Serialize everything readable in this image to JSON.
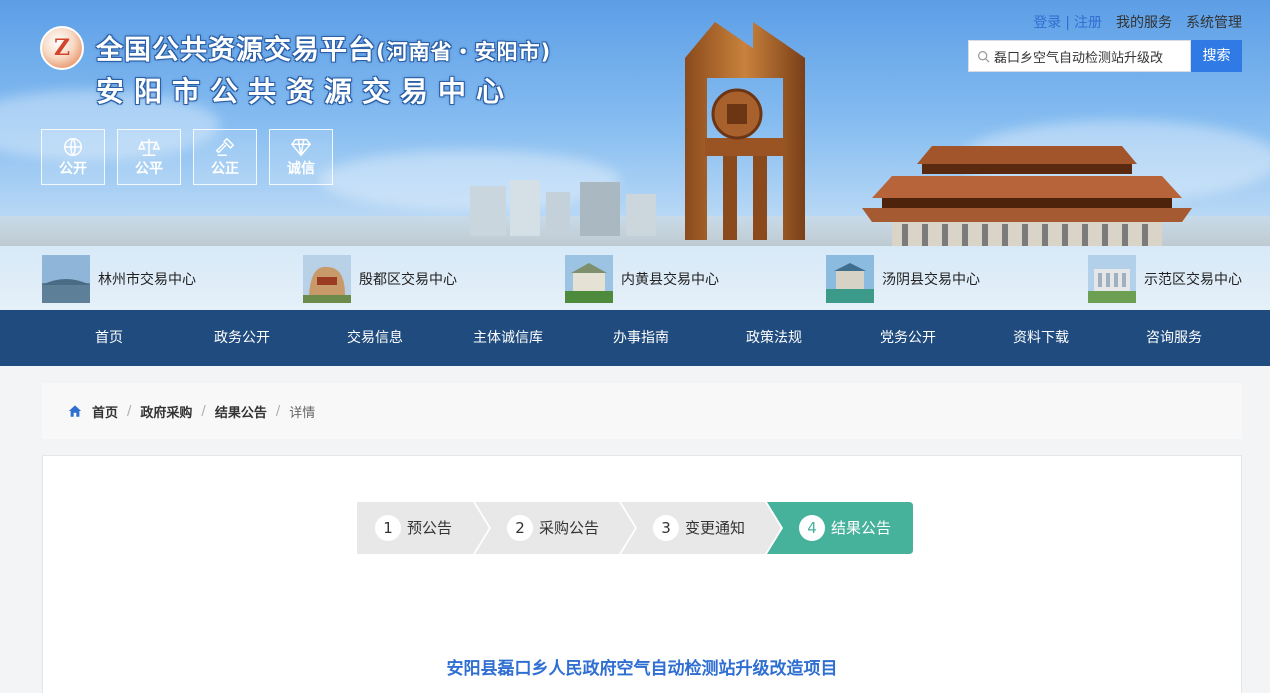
{
  "header": {
    "logo_letter": "Z",
    "title_main": "全国公共资源交易平台",
    "title_region": "(河南省・安阳市)",
    "title_sub": "安阳市公共资源交易中心",
    "values": [
      {
        "label": "公开",
        "icon": "globe-icon"
      },
      {
        "label": "公平",
        "icon": "scale-icon"
      },
      {
        "label": "公正",
        "icon": "gavel-icon"
      },
      {
        "label": "诚信",
        "icon": "diamond-icon"
      }
    ]
  },
  "top_links": {
    "login": "登录",
    "separator": "|",
    "register": "注册",
    "my_services": "我的服务",
    "system_admin": "系统管理"
  },
  "search": {
    "value": "磊口乡空气自动检测站升级改",
    "button": "搜索"
  },
  "centers": [
    {
      "label": "林州市交易中心"
    },
    {
      "label": "殷都区交易中心"
    },
    {
      "label": "内黄县交易中心"
    },
    {
      "label": "汤阴县交易中心"
    },
    {
      "label": "示范区交易中心"
    }
  ],
  "nav": [
    "首页",
    "政务公开",
    "交易信息",
    "主体诚信库",
    "办事指南",
    "政策法规",
    "党务公开",
    "资料下载",
    "咨询服务"
  ],
  "breadcrumb": {
    "home": "首页",
    "level1": "政府采购",
    "level2": "结果公告",
    "current": "详情",
    "separator": "/"
  },
  "steps": [
    {
      "num": "1",
      "label": "预公告"
    },
    {
      "num": "2",
      "label": "采购公告"
    },
    {
      "num": "3",
      "label": "变更通知"
    },
    {
      "num": "4",
      "label": "结果公告"
    }
  ],
  "document": {
    "title": "安阳县磊口乡人民政府空气自动检测站升级改造项目"
  },
  "colors": {
    "nav_bg": "#1f4b7e",
    "accent_blue": "#2f6fd1",
    "search_button": "#2f7ae5",
    "step_inactive": "#e8e8e8",
    "step_active": "#46b29c"
  }
}
